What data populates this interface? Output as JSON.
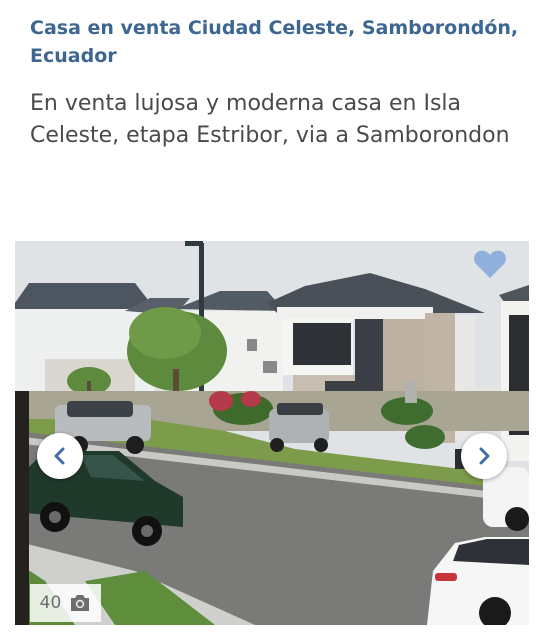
{
  "listing": {
    "location": "Casa en venta Ciudad Celeste, Samborondón, Ecuador",
    "title": "En venta lujosa y moderna casa en Isla Celeste, etapa Estribor, via a Samborondon"
  },
  "gallery": {
    "photo_count": "40",
    "favorite_icon": "heart-icon",
    "prev_icon": "chevron-left-icon",
    "next_icon": "chevron-right-icon",
    "camera_icon": "camera-icon"
  },
  "colors": {
    "location_text": "#3d6691",
    "title_text": "#4a4a4a",
    "favorite": "#8fb0dc",
    "nav_arrow": "#3d6ea8"
  }
}
